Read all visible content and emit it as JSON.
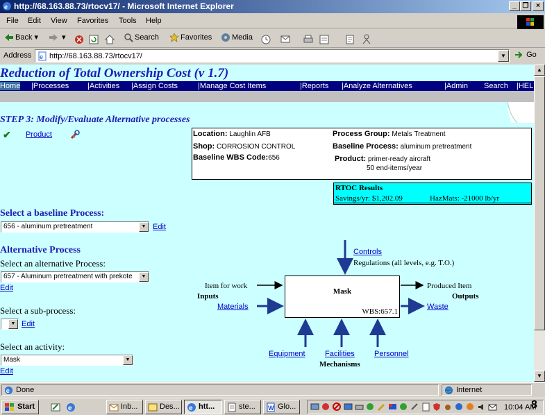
{
  "window": {
    "title": "http://68.163.88.73/rtocv17/ - Microsoft Internet Explorer",
    "minimize": "_",
    "restore": "❐",
    "close": "×"
  },
  "menu": [
    "File",
    "Edit",
    "View",
    "Favorites",
    "Tools",
    "Help"
  ],
  "toolbar": {
    "back": "Back",
    "search": "Search",
    "favorites": "Favorites",
    "media": "Media"
  },
  "address": {
    "label": "Address",
    "url": "http://68.163.88.73/rtocv17/",
    "go": "Go"
  },
  "app": {
    "title": "Reduction of Total Ownership Cost (v 1.7)",
    "nav": [
      {
        "label": "Home",
        "active": true
      },
      {
        "label": "|Processes"
      },
      {
        "label": "|Activities"
      },
      {
        "label": "|Assign Costs"
      },
      {
        "label": "|Manage Cost Items"
      },
      {
        "label": "|Reports"
      },
      {
        "label": "|Analyze Alternatives"
      },
      {
        "label": "|Admin"
      },
      {
        "label": "Search"
      },
      {
        "label": "|HELP"
      }
    ]
  },
  "step": {
    "title": "STEP 3: Modify/Evaluate Alternative processes",
    "product_link": "Product"
  },
  "info": {
    "location_key": "Location:",
    "location_val": "Laughlin AFB",
    "process_group_key": "Process Group:",
    "process_group_val": "Metals Treatment",
    "shop_key": "Shop:",
    "shop_val": "CORROSION CONTROL",
    "baseline_process_key": "Baseline Process:",
    "baseline_process_val": "aluminum pretreatment",
    "baseline_wbs_key": "Baseline WBS Code:",
    "baseline_wbs_val": "656",
    "product_key": "Product:",
    "product_val": "primer-ready aircraft",
    "product_qty": "50 end-items/year"
  },
  "rtoc": {
    "header": "RTOC Results",
    "savings": "Savings/yr: $1,202.09",
    "hazmats": "HazMats: -21000 lb/yr"
  },
  "baseline": {
    "heading": "Select a baseline Process:",
    "selected": "656 - aluminum pretreatment",
    "edit": "Edit"
  },
  "alternative": {
    "heading": "Alternative Process",
    "label": "Select an alternative Process:",
    "selected": "657 - Aluminum pretreatment with prekote",
    "edit": "Edit",
    "sub_label": "Select a sub-process:",
    "sub_selected": "",
    "sub_edit": "Edit",
    "activity_label": "Select an activity:",
    "activity_selected": "Mask",
    "activity_edit": "Edit"
  },
  "diagram": {
    "controls_link": "Controls",
    "controls_text": "Regulations (all levels, e.g. T.O.)",
    "item_for_work": "Item for work",
    "inputs": "Inputs",
    "materials": "Materials",
    "box_title": "Mask",
    "box_wbs": "WBS:657.1",
    "produced_item": "Produced Item",
    "outputs": "Outputs",
    "waste": "Waste",
    "equipment": "Equipment",
    "facilities": "Facilities",
    "personnel": "Personnel",
    "mechanisms": "Mechanisms"
  },
  "status": {
    "done": "Done",
    "zone": "Internet"
  },
  "taskbar": {
    "start": "Start",
    "tasks": [
      {
        "label": "Inb...",
        "active": false
      },
      {
        "label": "Des...",
        "active": false
      },
      {
        "label": "htt...",
        "active": true
      },
      {
        "label": "ste...",
        "active": false
      },
      {
        "label": "Glo...",
        "active": false
      }
    ],
    "time": "10:04 AM",
    "badge": "8"
  },
  "colors": {
    "content_bg": "#ccffff",
    "nav_bg": "#000080",
    "heading_blue": "#1e1eb4",
    "rtoc_bg": "#00ffff",
    "arrow_blue": "#1f3a93"
  }
}
